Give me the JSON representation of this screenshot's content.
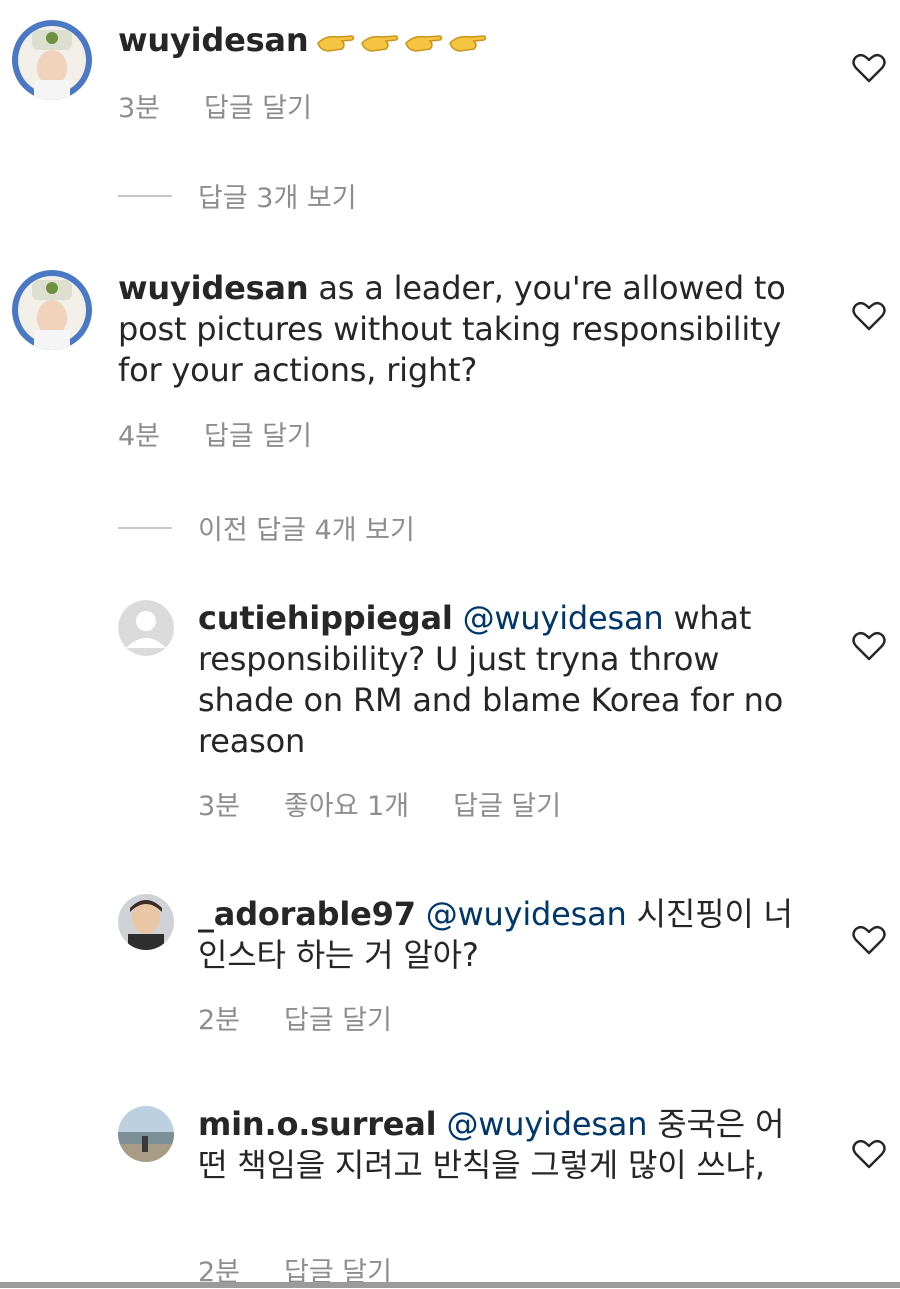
{
  "comments": [
    {
      "username": "wuyidesan",
      "text": "",
      "emoji": [
        "pointing-hand-emoji",
        "pointing-hand-emoji",
        "pointing-hand-emoji",
        "pointing-hand-emoji"
      ],
      "time": "3분",
      "likes": "",
      "reply": "답글 달기"
    },
    {
      "username": "wuyidesan",
      "text": "as a leader, you're allowed to post pictures without taking responsibility for your actions, right?",
      "time": "4분",
      "likes": "",
      "reply": "답글 달기"
    },
    {
      "username": "cutiehippiegal",
      "mention": "@wuyidesan",
      "text": "what responsibility? U just tryna throw shade on RM and blame Korea for no reason",
      "time": "3분",
      "likes": "좋아요 1개",
      "reply": "답글 달기"
    },
    {
      "username": "_adorable97",
      "mention": "@wuyidesan",
      "text": "시진핑이 너 인스타 하는 거 알아?",
      "time": "2분",
      "likes": "",
      "reply": "답글 달기"
    },
    {
      "username": "min.o.surreal",
      "mention": "@wuyidesan",
      "text": "중국은 어떤 책임을 지려고 반칙을 그렇게 많이 쓰냐,",
      "time": "2분",
      "likes": "",
      "reply": "답글 달기"
    }
  ],
  "view_replies": [
    {
      "label": "답글 3개 보기"
    },
    {
      "label": "이전 답글 4개 보기"
    }
  ],
  "colors": {
    "text": "#262626",
    "meta": "#8e8e8e",
    "mention": "#00376b",
    "emoji": "#f5c542"
  }
}
